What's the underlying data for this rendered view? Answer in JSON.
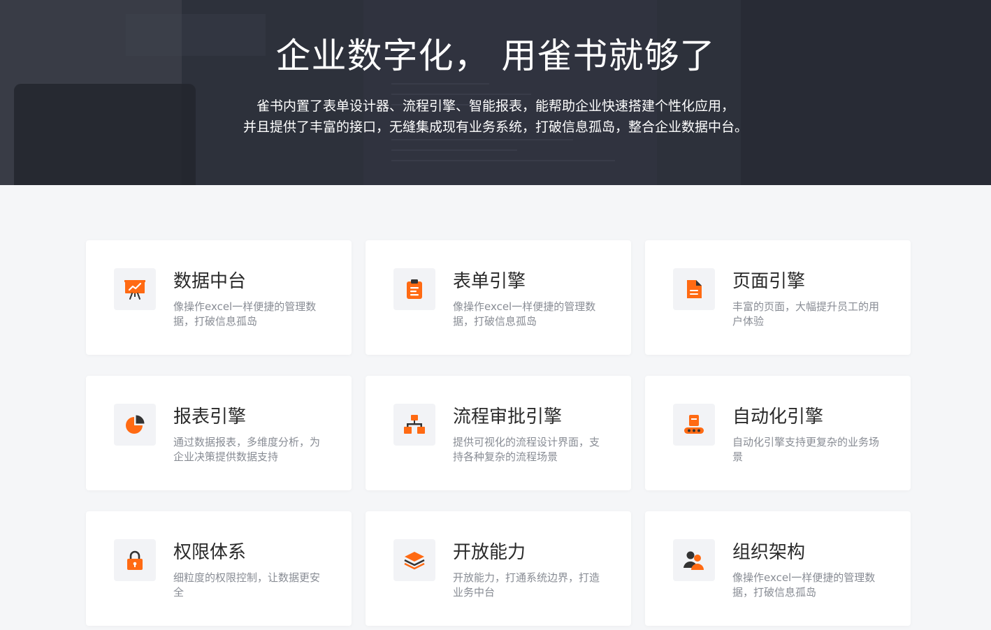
{
  "hero": {
    "title": "企业数字化， 用雀书就够了",
    "subtitle_line1": "雀书内置了表单设计器、流程引擎、智能报表，能帮助企业快速搭建个性化应用，",
    "subtitle_line2": "并且提供了丰富的接口，无缝集成现有业务系统，打破信息孤岛，整合企业数据中台。"
  },
  "colors": {
    "accent": "#ff6a13",
    "hero_bg": "#2c303a",
    "page_bg": "#f5f6f8",
    "card_bg": "#ffffff",
    "icon_bg": "#f2f3f6",
    "title_text": "#2a2a2a",
    "desc_text": "#888c94"
  },
  "features": [
    {
      "icon": "presentation-chart-icon",
      "title": "数据中台",
      "desc": "像操作excel一样便捷的管理数据，打破信息孤岛"
    },
    {
      "icon": "clipboard-icon",
      "title": "表单引擎",
      "desc": "像操作excel一样便捷的管理数据，打破信息孤岛"
    },
    {
      "icon": "document-icon",
      "title": "页面引擎",
      "desc": "丰富的页面，大幅提升员工的用户体验"
    },
    {
      "icon": "pie-chart-icon",
      "title": "报表引擎",
      "desc": "通过数据报表，多维度分析，为企业决策提供数据支持"
    },
    {
      "icon": "sitemap-icon",
      "title": "流程审批引擎",
      "desc": "提供可视化的流程设计界面，支持各种复杂的流程场景"
    },
    {
      "icon": "robot-conveyor-icon",
      "title": "自动化引擎",
      "desc": "自动化引擎支持更复杂的业务场景"
    },
    {
      "icon": "lock-icon",
      "title": "权限体系",
      "desc": "细粒度的权限控制，让数据更安全"
    },
    {
      "icon": "layers-icon",
      "title": "开放能力",
      "desc": "开放能力，打通系统边界，打造业务中台"
    },
    {
      "icon": "users-icon",
      "title": "组织架构",
      "desc": "像操作excel一样便捷的管理数据，打破信息孤岛"
    }
  ]
}
